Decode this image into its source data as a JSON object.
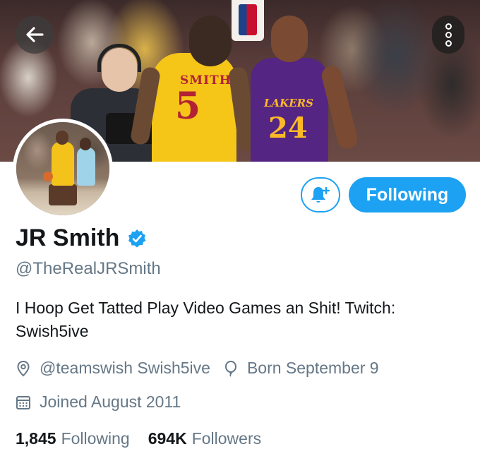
{
  "banner": {
    "nav": {
      "back_icon": "arrow-left-icon",
      "more_icon": "more-vertical-icon"
    },
    "jersey_smith": {
      "name": "SMITH",
      "number": "5"
    },
    "jersey_kobe": {
      "name": "LAKERS",
      "number": "24"
    }
  },
  "actions": {
    "notify_icon": "bell-plus-icon",
    "follow_label": "Following"
  },
  "profile": {
    "display_name": "JR Smith",
    "verified_icon": "verified-badge-icon",
    "handle": "@TheRealJRSmith",
    "bio": "I Hoop Get Tatted Play Video Games an Shit! Twitch: Swish5ive",
    "location": "@teamswish Swish5ive",
    "birthday": "Born September 9",
    "joined": "Joined August 2011"
  },
  "stats": {
    "following_count": "1,845",
    "following_label": "Following",
    "followers_count": "694K",
    "followers_label": "Followers"
  },
  "colors": {
    "accent": "#1da1f2",
    "secondary_text": "#657786",
    "primary_text": "#14171a"
  }
}
